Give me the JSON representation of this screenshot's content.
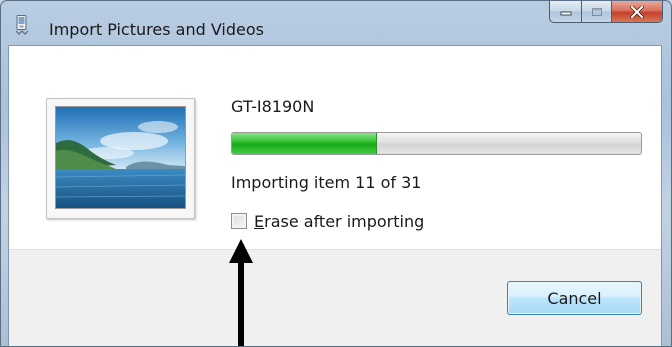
{
  "window": {
    "title": "Import Pictures and Videos"
  },
  "device": {
    "name": "GT-I8190N"
  },
  "progress": {
    "current_item": 11,
    "total_items": 31,
    "fraction": 0.3548,
    "status_text": "Importing item 11 of 31"
  },
  "options": {
    "erase_label_accel": "E",
    "erase_label_rest": "rase after importing",
    "erase_checked": false
  },
  "buttons": {
    "cancel_label": "Cancel"
  },
  "icons": {
    "title": "camera-device-icon",
    "minimize": "minimize-icon",
    "maximize": "maximize-icon",
    "close": "close-icon"
  },
  "colors": {
    "progress_green": "#17a817",
    "close_red": "#c2412a",
    "button_border": "#3c7fb1"
  }
}
